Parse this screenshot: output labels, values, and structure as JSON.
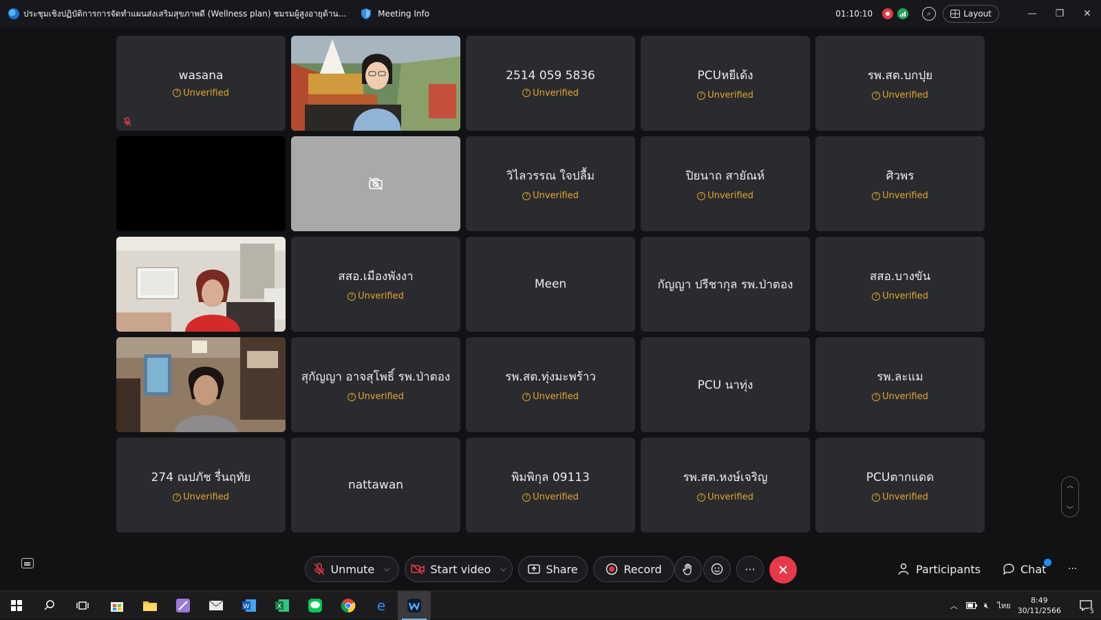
{
  "titlebar": {
    "meeting_title": "ประชุมเชิงปฏิบัติการการจัดทำแผนส่งเสริมสุขภาพดี  (Wellness plan)  ชมรมผู้สูงอายุด้าน...",
    "meeting_info_label": "Meeting Info",
    "timer": "01:10:10",
    "layout_label": "Layout"
  },
  "tiles": [
    {
      "type": "name",
      "name": "wasana",
      "unverified": "Unverified",
      "muted": true
    },
    {
      "type": "video",
      "scene": "woman-temple-background"
    },
    {
      "type": "name",
      "name": "2514 059 5836",
      "unverified": "Unverified"
    },
    {
      "type": "name",
      "name": "PCUหยีเด้ง",
      "unverified": "Unverified"
    },
    {
      "type": "name",
      "name": "รพ.สต.บกปุย",
      "unverified": "Unverified"
    },
    {
      "type": "black"
    },
    {
      "type": "camera-off"
    },
    {
      "type": "name",
      "name": "วิไลวรรณ ใจปลื้ม",
      "unverified": "Unverified"
    },
    {
      "type": "name",
      "name": "ปิยนาถ สายัณห์",
      "unverified": "Unverified"
    },
    {
      "type": "name",
      "name": "ศิวพร",
      "unverified": "Unverified"
    },
    {
      "type": "video",
      "scene": "woman-office-red-shirt"
    },
    {
      "type": "name",
      "name": "สสอ.เมืองพังงา",
      "unverified": "Unverified"
    },
    {
      "type": "name",
      "name": "Meen",
      "unverified": ""
    },
    {
      "type": "name",
      "name": "กัญญา ปรีชากุล รพ.ป่าตอง",
      "unverified": ""
    },
    {
      "type": "name",
      "name": "สสอ.บางขัน",
      "unverified": "Unverified"
    },
    {
      "type": "video",
      "scene": "woman-office-desk"
    },
    {
      "type": "name",
      "name": "สุกัญญา อาจสุโพธิ์ รพ.ป่าตอง",
      "unverified": "Unverified"
    },
    {
      "type": "name",
      "name": "รพ.สต.ทุ่งมะพร้าว",
      "unverified": "Unverified"
    },
    {
      "type": "name",
      "name": "PCU นาทุ่ง",
      "unverified": ""
    },
    {
      "type": "name",
      "name": "รพ.ละแม",
      "unverified": "Unverified"
    },
    {
      "type": "name",
      "name": "274 ณปภัช รื่นฤทัย",
      "unverified": "Unverified"
    },
    {
      "type": "name",
      "name": "nattawan",
      "unverified": ""
    },
    {
      "type": "name",
      "name": "พิมพิกุล  09113",
      "unverified": "Unverified"
    },
    {
      "type": "name",
      "name": "รพ.สต.หงษ์เจริญ",
      "unverified": "Unverified"
    },
    {
      "type": "name",
      "name": "PCUตากแดด",
      "unverified": "Unverified"
    }
  ],
  "controls": {
    "unmute": "Unmute",
    "start_video": "Start video",
    "share": "Share",
    "record": "Record",
    "more": "···",
    "participants": "Participants",
    "chat": "Chat",
    "overflow": "···"
  },
  "taskbar": {
    "lang": "ไทย",
    "time": "8:49",
    "date": "30/11/2566",
    "notifications": "5"
  },
  "colors": {
    "accent_end": "#e8394a",
    "unverified": "#e3a72f",
    "active_app": "#76b9ed"
  }
}
